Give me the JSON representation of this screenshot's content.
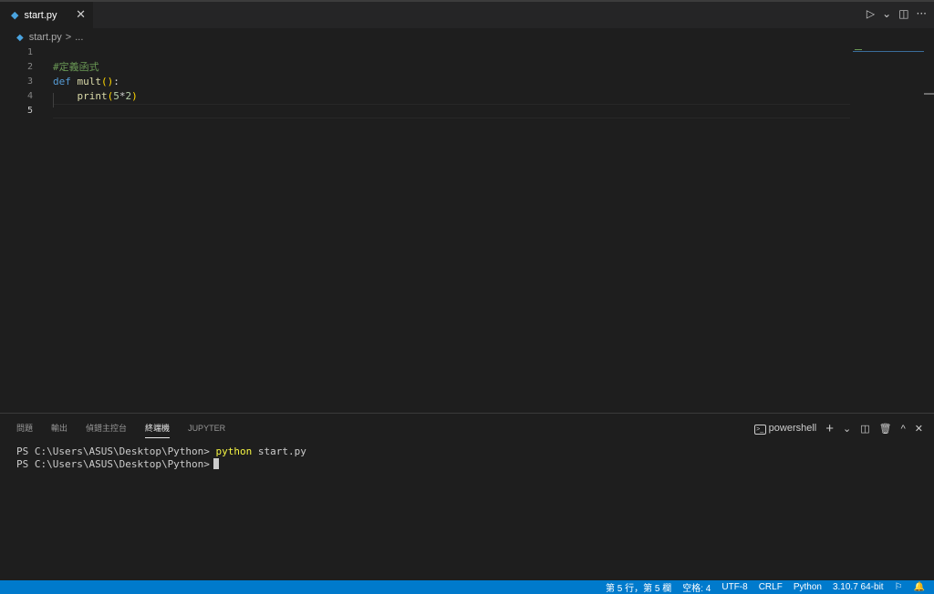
{
  "tab": {
    "filename": "start.py",
    "close_glyph": "✕"
  },
  "tab_actions": {
    "run": "▷",
    "run_menu": "⌄",
    "split": "◫",
    "more": "···"
  },
  "breadcrumb": {
    "file": "start.py",
    "separator": ">",
    "more": "..."
  },
  "editor": {
    "line_numbers": [
      "1",
      "2",
      "3",
      "4",
      "5"
    ],
    "active_line": 5,
    "lines": {
      "comment": "#定義函式",
      "def_kw": "def",
      "func_name": "mult",
      "paren_open": "(",
      "paren_close": ")",
      "colon": ":",
      "indent": "    ",
      "print_fn": "print",
      "print_open": "(",
      "num_a": "5",
      "op": "*",
      "num_b": "2",
      "print_close": ")"
    }
  },
  "panel": {
    "tabs": [
      "問題",
      "輸出",
      "偵錯主控台",
      "終端機",
      "JUPYTER"
    ],
    "active_tab": "終端機",
    "shell_icon": ">_",
    "shell": "powershell",
    "add": "+",
    "add_menu": "⌄",
    "split": "◫",
    "trash": "🗑",
    "maximize": "^",
    "close": "✕",
    "terminal": {
      "prompt1": "PS C:\\Users\\ASUS\\Desktop\\Python> ",
      "command1": "python",
      "args1": " start.py",
      "prompt2": "PS C:\\Users\\ASUS\\Desktop\\Python>"
    }
  },
  "statusbar": {
    "position": "第 5 行，第 5 欄",
    "spaces": "空格: 4",
    "encoding": "UTF-8",
    "eol": "CRLF",
    "language": "Python",
    "interpreter": "3.10.7 64-bit",
    "feedback_icon": "⚐",
    "bell_icon": "🔔"
  },
  "colors": {
    "accent": "#007acc",
    "editor_bg": "#1e1e1e",
    "comment": "#6a9955",
    "keyword": "#569cd6"
  }
}
